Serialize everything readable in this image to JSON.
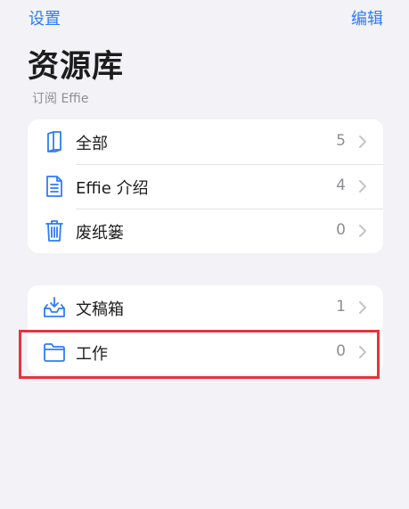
{
  "nav": {
    "back_label": "设置",
    "edit_label": "编辑"
  },
  "header": {
    "title": "资源库",
    "subtitle": "订阅 Effie"
  },
  "library": {
    "items": [
      {
        "label": "全部",
        "count": "5",
        "icon": "book-icon"
      },
      {
        "label": "Effie 介绍",
        "count": "4",
        "icon": "document-icon"
      },
      {
        "label": "废纸篓",
        "count": "0",
        "icon": "trash-icon"
      }
    ]
  },
  "folders": {
    "items": [
      {
        "label": "文稿箱",
        "count": "1",
        "icon": "inbox-tray-icon"
      },
      {
        "label": "工作",
        "count": "0",
        "icon": "folder-icon"
      }
    ]
  },
  "colors": {
    "accent": "#2f7cf6",
    "background": "#f2f2f7",
    "highlight": "#e8323a"
  }
}
